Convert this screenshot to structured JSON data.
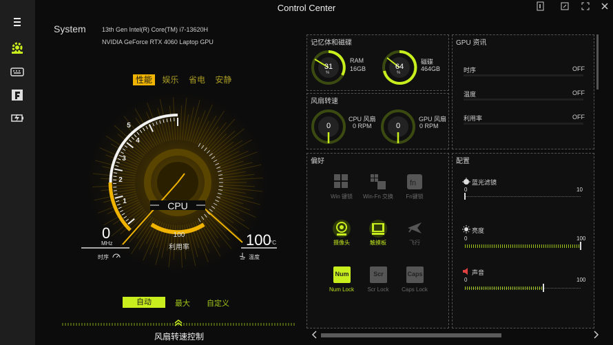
{
  "window": {
    "title": "Control Center"
  },
  "sidebar": {
    "items": [
      {
        "name": "menu-icon",
        "active": false
      },
      {
        "name": "system-gear-icon",
        "active": true
      },
      {
        "name": "keyboard-icon",
        "active": false
      },
      {
        "name": "fn-f-icon",
        "active": false
      },
      {
        "name": "battery-charge-icon",
        "active": false
      }
    ]
  },
  "system": {
    "label": "System",
    "cpu": "13th Gen Intel(R) Core(TM) i7-13620H",
    "gpu": "NVIDIA GeForce RTX 4060 Laptop GPU"
  },
  "modes": {
    "items": [
      "性能",
      "娱乐",
      "省电",
      "安静"
    ],
    "selected": "性能"
  },
  "gauge": {
    "label": "CPU",
    "ticks": [
      "1",
      "2",
      "3",
      "4",
      "5"
    ],
    "freq_value": "0",
    "freq_unit": "MHz",
    "clock_label": "时序",
    "usage_value": "100",
    "usage_label": "利用率",
    "temp_value": "100",
    "temp_unit": "°C",
    "temp_label": "温度"
  },
  "fan_modes": {
    "items": [
      "自动",
      "最大",
      "自定义"
    ],
    "selected": "自动",
    "control_label": "风扇转速控制"
  },
  "memory": {
    "title": "记忆体和磁碟",
    "ram": {
      "value": "31",
      "unit": "%",
      "label": "RAM",
      "size": "16GB"
    },
    "disk": {
      "value": "64",
      "unit": "%",
      "label": "磁碟",
      "size": "464GB"
    }
  },
  "fans": {
    "title": "风扇转速",
    "cpu": {
      "value": "0",
      "label": "CPU 风扇",
      "rpm": "0 RPM"
    },
    "gpu": {
      "value": "0",
      "label": "GPU 风扇",
      "rpm": "0 RPM"
    }
  },
  "gpu_info": {
    "title": "GPU 资讯",
    "rows": [
      {
        "label": "时序",
        "value": "OFF"
      },
      {
        "label": "温度",
        "value": "OFF"
      },
      {
        "label": "利用率",
        "value": "OFF"
      }
    ]
  },
  "preferences": {
    "title": "偏好",
    "items": [
      {
        "label": "Win 键锁",
        "icon": "windows-lock-icon",
        "enabled": false
      },
      {
        "label": "Win-Fn 交换",
        "icon": "win-fn-swap-icon",
        "enabled": false
      },
      {
        "label": "Fn键锁",
        "icon": "fn-lock-icon",
        "enabled": false
      },
      {
        "label": "摄像头",
        "icon": "camera-icon",
        "enabled": true
      },
      {
        "label": "触摸板",
        "icon": "touchpad-icon",
        "enabled": true
      },
      {
        "label": "飞行",
        "icon": "airplane-icon",
        "enabled": false
      },
      {
        "label": "Num Lock",
        "icon": "num-lock-icon",
        "key": "Num",
        "enabled": true
      },
      {
        "label": "Scr Lock",
        "icon": "scroll-lock-icon",
        "key": "Scr",
        "enabled": false
      },
      {
        "label": "Caps Lock",
        "icon": "caps-lock-icon",
        "key": "Caps",
        "enabled": false
      }
    ]
  },
  "config": {
    "title": "配置",
    "sliders": [
      {
        "label": "蓝光滤镜",
        "icon": "blue-light-icon",
        "min": "0",
        "max": "10",
        "value": 0
      },
      {
        "label": "亮度",
        "icon": "brightness-icon",
        "min": "0",
        "max": "100",
        "value": 100
      },
      {
        "label": "声音",
        "icon": "volume-icon",
        "min": "0",
        "max": "100",
        "value": 68
      }
    ]
  },
  "colors": {
    "accent": "#c8ee1e",
    "gold": "#f0b400",
    "panel_border": "#555555"
  }
}
